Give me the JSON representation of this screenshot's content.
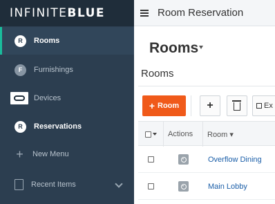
{
  "brand": {
    "text_light": "INFINITE",
    "text_bold": "BLUE"
  },
  "sidebar": {
    "items": [
      {
        "badge": "R",
        "label": "Rooms"
      },
      {
        "badge": "F",
        "label": "Furnishings"
      },
      {
        "label": "Devices"
      },
      {
        "badge": "R",
        "label": "Reservations"
      },
      {
        "label": "New Menu"
      },
      {
        "label": "Recent Items"
      }
    ]
  },
  "topbar": {
    "title": "Room Reservation"
  },
  "page": {
    "title": "Rooms",
    "section_title": "Rooms"
  },
  "toolbar": {
    "add_room_plus": "+",
    "add_room_label": "Room",
    "add_label": "+",
    "export_label": "Ex"
  },
  "table": {
    "columns": {
      "actions": "Actions",
      "room": "Room ▾"
    },
    "rows": [
      {
        "room": "Overflow Dining"
      },
      {
        "room": "Main Lobby"
      }
    ]
  },
  "colors": {
    "sidebar_bg": "#2c3e50",
    "accent": "#1abc9c",
    "primary_button": "#f05a1a",
    "link": "#1a5ea8"
  }
}
